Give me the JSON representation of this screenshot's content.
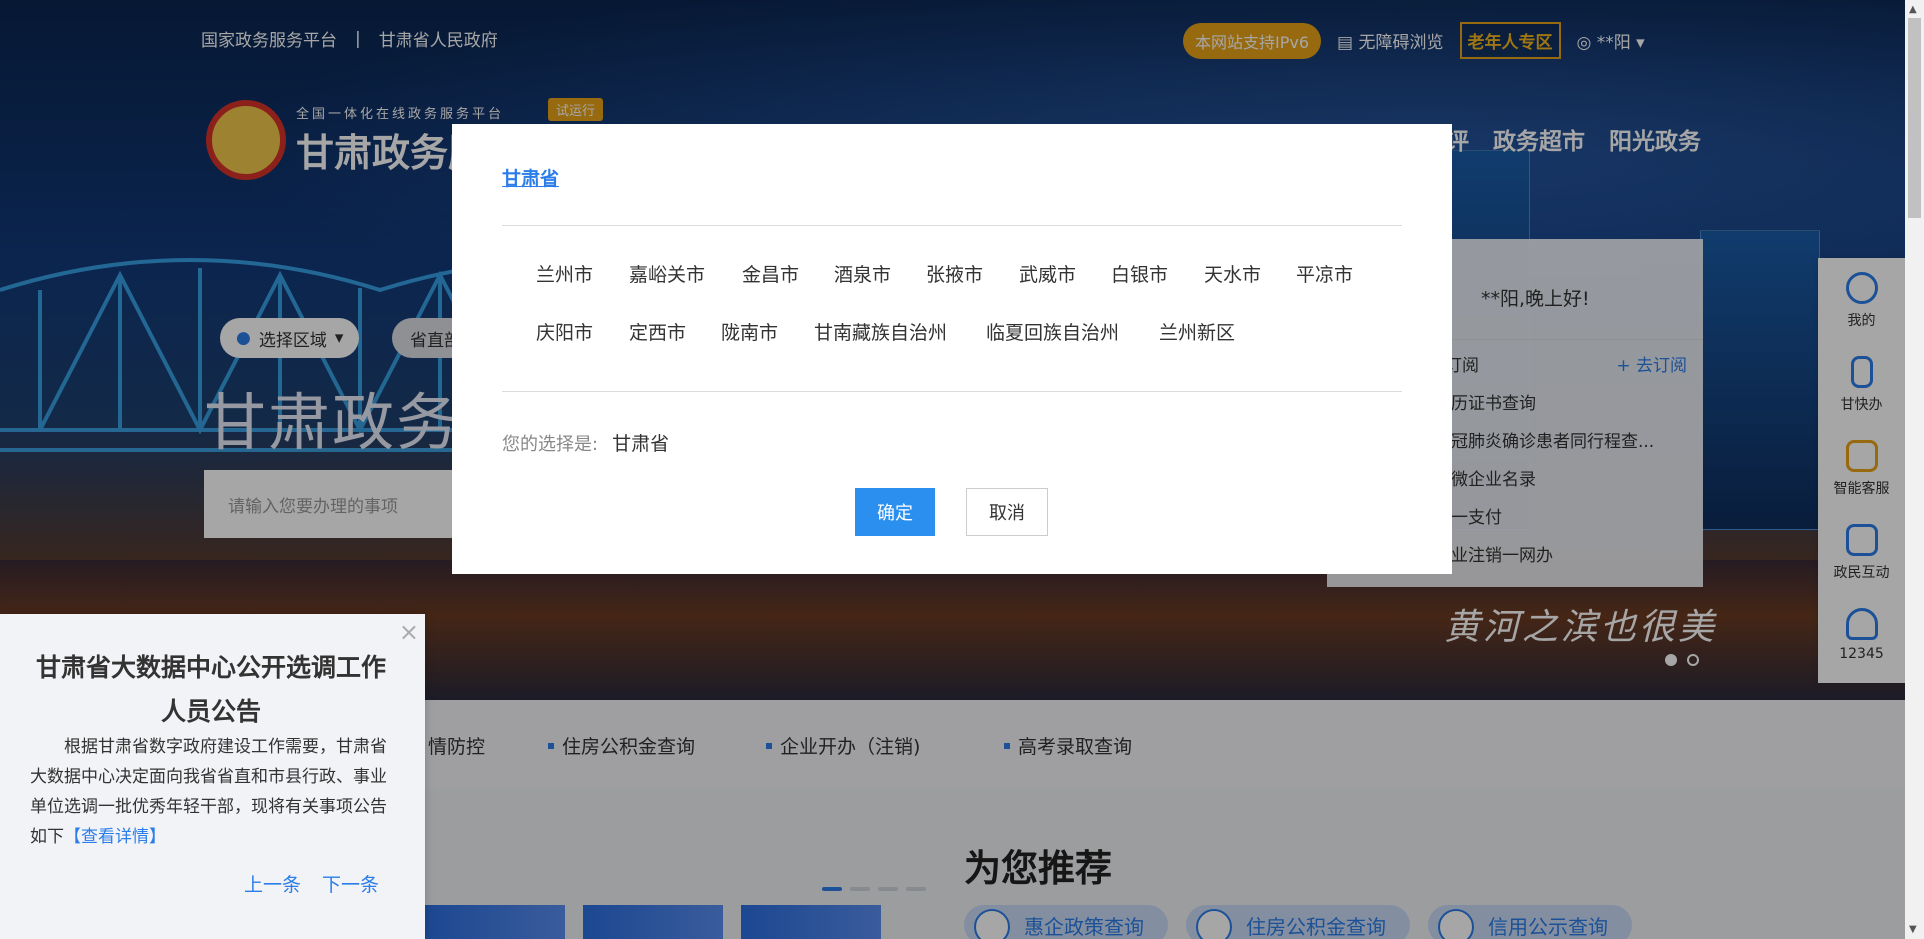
{
  "topbar": {
    "national_platform": "国家政务服务平台",
    "separator": "|",
    "gansu_gov": "甘肃省人民政府",
    "ipv6": "本网站支持IPv6",
    "accessibility": "无障碍浏览",
    "elderly": "老年人专区",
    "user": "**阳 ▾"
  },
  "logo": {
    "subtitle": "全国一体化在线政务服务平台",
    "title": "甘肃政务服",
    "trial": "试运行"
  },
  "nav_right": [
    "评",
    "政务超市",
    "阳光政务"
  ],
  "region": {
    "label": "选择区域",
    "arrow": "▾",
    "second": "省直部"
  },
  "hero": {
    "title": "甘肃政务服",
    "search_placeholder": "请输入您要办理的事项",
    "slogan": "黄河之滨也很美"
  },
  "welcome": {
    "greeting": "**阳,晚上好!",
    "subscribe_header": "订阅",
    "subscribe_link": "+ 去订阅",
    "items": [
      "历证书查询",
      "冠肺炎确诊患者同行程查...",
      "微企业名录",
      "一支付",
      "业注销一网办"
    ]
  },
  "side_bar": [
    {
      "label": "我的",
      "icon": "user-icon"
    },
    {
      "label": "甘快办",
      "icon": "phone-icon"
    },
    {
      "label": "智能客服",
      "icon": "robot-icon"
    },
    {
      "label": "政民互动",
      "icon": "chat-icon"
    },
    {
      "label": "12345",
      "icon": "headset-icon"
    }
  ],
  "quick_links": [
    "情防控",
    "住房公积金查询",
    "企业开办（注销)",
    "高考录取查询"
  ],
  "recommend": {
    "title": "为您推荐",
    "pills": [
      "惠企政策查询",
      "住房公积金查询",
      "信用公示查询"
    ]
  },
  "notice": {
    "close": "×",
    "title": "甘肃省大数据中心公开选调工作人员公告",
    "body": "根据甘肃省数字政府建设工作需要，甘肃省大数据中心决定面向我省省直和市县行政、事业单位选调一批优秀年轻干部，现将有关事项公告如下",
    "link": "【查看详情】",
    "prev": "上一条",
    "next": "下一条"
  },
  "dialog": {
    "province": "甘肃省",
    "cities": [
      "兰州市",
      "嘉峪关市",
      "金昌市",
      "酒泉市",
      "张掖市",
      "武威市",
      "白银市",
      "天水市",
      "平凉市",
      "庆阳市",
      "定西市",
      "陇南市",
      "甘南藏族自治州",
      "临夏回族自治州",
      "兰州新区"
    ],
    "choice_label": "您的选择是:",
    "choice_value": "甘肃省",
    "ok": "确定",
    "cancel": "取消"
  },
  "colors": {
    "accent": "#2b7de9",
    "ok_button": "#2b8ff0",
    "badge": "#e9a41a"
  }
}
